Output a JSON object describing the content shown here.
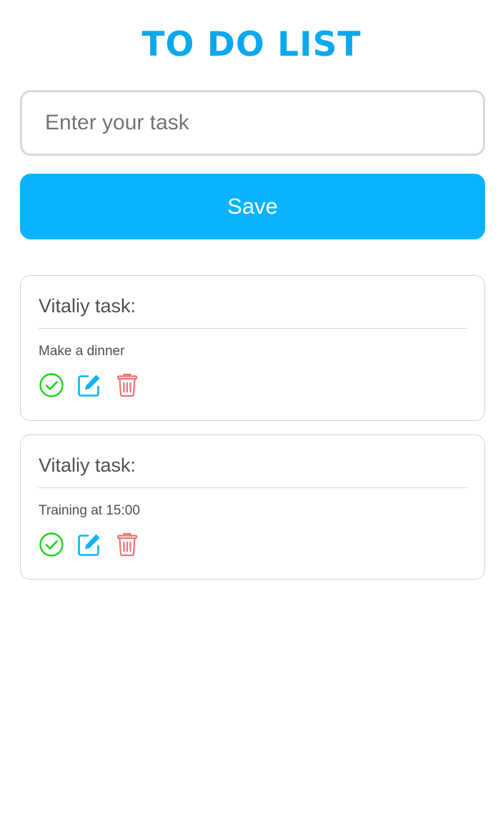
{
  "header": {
    "title": "TO DO LIST"
  },
  "form": {
    "input_placeholder": "Enter your task",
    "input_value": "",
    "save_label": "Save"
  },
  "tasks": [
    {
      "title": "Vitaliy task:",
      "text": "Make a dinner",
      "actions": [
        "check-circle-icon",
        "edit-icon",
        "trash-icon"
      ]
    },
    {
      "title": "Vitaliy task:",
      "text": "Training at 15:00",
      "actions": [
        "check-circle-icon",
        "edit-icon",
        "trash-icon"
      ]
    }
  ],
  "colors": {
    "accent": "#0ab3ff",
    "title": "#0aa9ef",
    "done": "#1ed01e",
    "edit": "#0ab3ff",
    "delete": "#f07272",
    "text": "#505050",
    "border": "#d6d6d6"
  }
}
